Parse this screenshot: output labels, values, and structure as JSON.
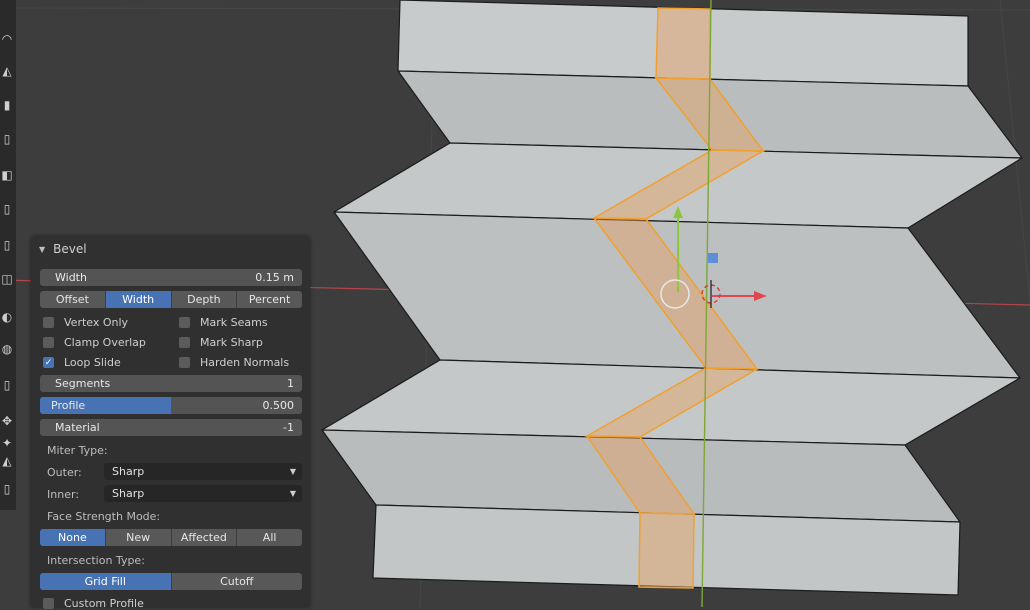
{
  "panel": {
    "title": "Bevel",
    "width": {
      "label": "Width",
      "value": "0.15 m"
    },
    "width_type": {
      "options": [
        "Offset",
        "Width",
        "Depth",
        "Percent"
      ],
      "selected": "Width"
    },
    "checkboxes_left": [
      {
        "label": "Vertex Only",
        "checked": false
      },
      {
        "label": "Clamp Overlap",
        "checked": false
      },
      {
        "label": "Loop Slide",
        "checked": true
      }
    ],
    "checkboxes_right": [
      {
        "label": "Mark Seams",
        "checked": false
      },
      {
        "label": "Mark Sharp",
        "checked": false
      },
      {
        "label": "Harden Normals",
        "checked": false
      }
    ],
    "segments": {
      "label": "Segments",
      "value": "1"
    },
    "profile": {
      "label": "Profile",
      "value": "0.500",
      "fraction": 0.5
    },
    "material": {
      "label": "Material",
      "value": "-1"
    },
    "miter_type_label": "Miter Type:",
    "outer": {
      "label": "Outer:",
      "value": "Sharp"
    },
    "inner": {
      "label": "Inner:",
      "value": "Sharp"
    },
    "face_strength": {
      "label": "Face Strength Mode:",
      "options": [
        "None",
        "New",
        "Affected",
        "All"
      ],
      "selected": "None"
    },
    "intersection": {
      "label": "Intersection Type:",
      "options": [
        "Grid Fill",
        "Cutoff"
      ],
      "selected": "Grid Fill"
    },
    "custom_profile": {
      "label": "Custom Profile",
      "checked": false
    }
  },
  "colors": {
    "background": "#3d3d3d",
    "panel": "#303030",
    "accent": "#4772b3",
    "mesh_face": "#bfc3c4",
    "selection": "#f2a33a",
    "x_axis": "#c9474f",
    "y_axis": "#7fa733"
  },
  "toolbar_icons": [
    "curve-icon",
    "annulus-icon",
    "extrude-icon",
    "extrude-region-icon",
    "inset-icon",
    "bevel-icon",
    "loop-cut-icon",
    "knife-icon",
    "poly-build-icon",
    "spin-icon",
    "smooth-icon",
    "edge-slide-icon",
    "shrink-fatten-icon",
    "shear-icon",
    "rip-icon",
    "measure-icon",
    "cube-icon"
  ]
}
